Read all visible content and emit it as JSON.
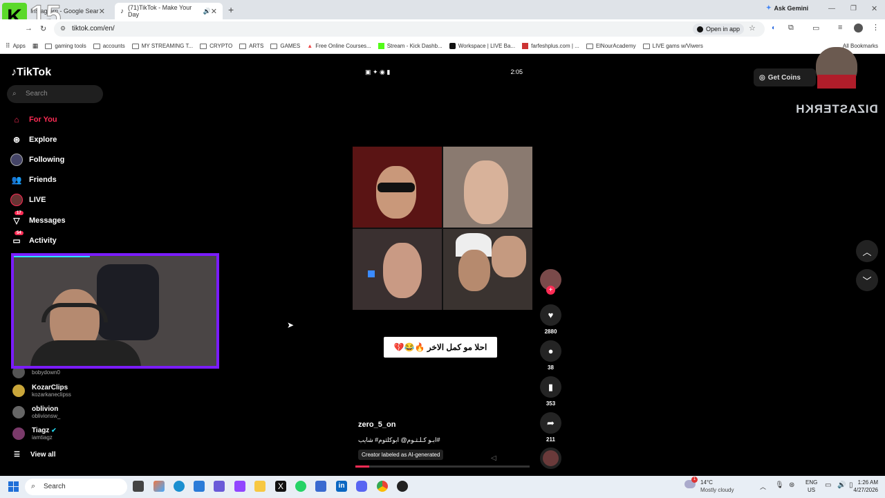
{
  "browser": {
    "tab1_title": "Instagram - Google Search",
    "tab2_title": "(71)TikTok - Make Your Day",
    "url": "tiktok.com/en/",
    "open_in_app": "Open in app",
    "ask_gemini": "Ask Gemini",
    "bookmarks": [
      "Apps",
      "gaming tools",
      "accounts",
      "MY STREAMING T...",
      "CRYPTO",
      "ARTS",
      "GAMES",
      "Free Online Courses...",
      "Stream - Kick Dashb...",
      "Workspace | LIVE Ba...",
      "farfeshplus.com | ...",
      "ElNourAcademy",
      "LIVE gams w/Viwers"
    ],
    "all_bookmarks": "All Bookmarks"
  },
  "overlay": {
    "stream_counter": "15"
  },
  "tiktok": {
    "logo": "TikTok",
    "search_placeholder": "Search",
    "nav": [
      {
        "label": "For You",
        "active": true
      },
      {
        "label": "Explore"
      },
      {
        "label": "Following"
      },
      {
        "label": "Friends"
      },
      {
        "label": "LIVE"
      },
      {
        "label": "Messages",
        "badge": "17"
      },
      {
        "label": "Activity",
        "badge": "54"
      }
    ],
    "accounts": [
      {
        "handle": "bobydown0"
      },
      {
        "name": "KozarClips",
        "handle": "kozarkaneclipss"
      },
      {
        "name": "oblivion",
        "handle": "oblivionsw_"
      },
      {
        "name": "Tiagz",
        "handle": "iamtiagz",
        "verified": true
      }
    ],
    "view_all": "View all",
    "get_coins": "Get Coins",
    "video": {
      "status_time": "2:05",
      "caption_overlay": "احلا مو كمل الاخر 🔥😂💔",
      "author": "zero_5_on",
      "description": "ابـو كـلـثـوم@ ابوكلثوم# شايب#",
      "ai_label": "Creator labeled as AI-generated",
      "likes": "2880",
      "comments": "38",
      "saves": "353",
      "shares": "211"
    }
  },
  "streamer_watermark": "DIZASTERKH",
  "taskbar": {
    "search": "Search",
    "weather_temp": "14°C",
    "weather_desc": "Mostly cloudy",
    "lang": "ENG",
    "region": "US",
    "time": "1:26 AM",
    "date": "4/27/2026",
    "weather_alert": "1"
  },
  "colors": {
    "accent": "#fe2c55",
    "webcam_border": "#7b1cff"
  }
}
